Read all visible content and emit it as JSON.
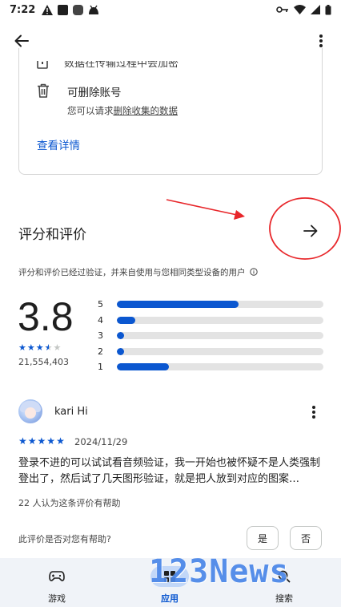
{
  "status_bar": {
    "time": "7:22",
    "left_icons": [
      "warning-icon",
      "square-icon",
      "square-rounded-icon",
      "android-icon"
    ],
    "right_icons": [
      "key-icon",
      "wifi-icon",
      "signal-icon",
      "battery-icon"
    ]
  },
  "top_bar": {
    "back_icon": "arrow-back-icon",
    "more_icon": "more-vert-icon"
  },
  "data_safety_card": {
    "partial_row_text": "数据在传输过程中会加密",
    "delete_title": "可删除账号",
    "delete_desc_prefix": "您可以请求",
    "delete_desc_link": "删除收集的数据",
    "details_link": "查看详情"
  },
  "ratings": {
    "section_title": "评分和评价",
    "verify_note": "评分和评价已经过验证，并来自使用与您相同类型设备的用户",
    "score": "3.8",
    "review_count": "21,554,403",
    "stars_filled": 3.5,
    "histogram": [
      {
        "label": "5",
        "fraction": 0.59
      },
      {
        "label": "4",
        "fraction": 0.09
      },
      {
        "label": "3",
        "fraction": 0.035
      },
      {
        "label": "2",
        "fraction": 0.035
      },
      {
        "label": "1",
        "fraction": 0.25
      }
    ]
  },
  "review": {
    "author": "kari Hi",
    "date": "2024/11/29",
    "stars": 5,
    "text": "登录不进的可以试试看音频验证，我一开始也被怀疑不是人类强制登出了，然后试了几天图形验证，就是把人放到对应的图案…",
    "helpful_count": "22 人认为这条评价有帮助",
    "helpful_question": "此评价是否对您有帮助?",
    "yes_label": "是",
    "no_label": "否"
  },
  "bottom_nav": {
    "items": [
      {
        "label": "游戏",
        "icon": "gamepad-icon",
        "active": false
      },
      {
        "label": "应用",
        "icon": "apps-grid-icon",
        "active": true
      },
      {
        "label": "搜索",
        "icon": "search-icon",
        "active": false
      }
    ]
  },
  "watermark": {
    "text": "123News"
  },
  "colors": {
    "accent": "#0b57d0",
    "annotation_red": "#e8262a"
  }
}
